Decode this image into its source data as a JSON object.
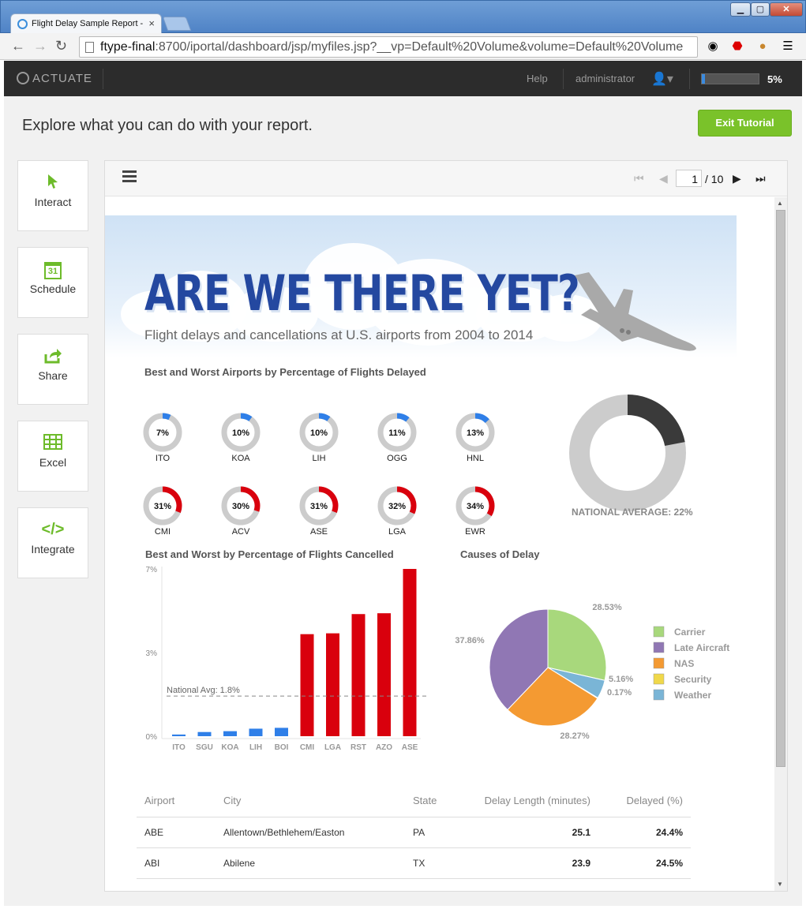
{
  "browser": {
    "tab_title": "Flight Delay Sample Report - ",
    "tab_close": "×",
    "url_host": "ftype-final",
    "url_rest": ":8700/iportal/dashboard/jsp/myfiles.jsp?__vp=Default%20Volume&volume=Default%20Volume"
  },
  "app": {
    "logo": "ACTUATE",
    "help": "Help",
    "user": "administrator",
    "progress_text": "5%",
    "progress_fraction": 0.05
  },
  "tutorial": {
    "heading": "Explore what you can do with your report.",
    "exit_label": "Exit Tutorial",
    "sidebar": [
      {
        "label": "Interact",
        "icon": "cursor-icon"
      },
      {
        "label": "Schedule",
        "icon": "calendar-icon",
        "icon_text": "31"
      },
      {
        "label": "Share",
        "icon": "share-icon"
      },
      {
        "label": "Excel",
        "icon": "grid-icon"
      },
      {
        "label": "Integrate",
        "icon": "code-icon",
        "icon_text": "</>"
      }
    ]
  },
  "viewer": {
    "page_current": "1",
    "page_total": "/ 10"
  },
  "report": {
    "title": "ARE WE THERE YET?",
    "subtitle": "Flight delays and cancellations at U.S. airports from 2004 to 2014",
    "delayed_title": "Best and Worst Airports by Percentage of Flights Delayed",
    "cancelled_title": "Best and Worst by Percentage of Flights Cancelled",
    "causes_title": "Causes of Delay",
    "national_avg_label": "NATIONAL AVERAGE: 22%",
    "table": {
      "headers": [
        "Airport",
        "City",
        "State",
        "Delay Length (minutes)",
        "Delayed (%)"
      ],
      "rows": [
        [
          "ABE",
          "Allentown/Bethlehem/Easton",
          "PA",
          "25.1",
          "24.4%"
        ],
        [
          "ABI",
          "Abilene",
          "TX",
          "23.9",
          "24.5%"
        ]
      ]
    }
  },
  "colors": {
    "best_arc": "#2f7fe8",
    "worst_arc": "#d9000d",
    "ring_bg": "#cccccc",
    "nat_dark": "#3a3a3a"
  },
  "chart_data": [
    {
      "type": "donut",
      "title": "Best and Worst Airports by Percentage of Flights Delayed",
      "best": [
        {
          "label": "ITO",
          "value": 7,
          "text": "7%"
        },
        {
          "label": "KOA",
          "value": 10,
          "text": "10%"
        },
        {
          "label": "LIH",
          "value": 10,
          "text": "10%"
        },
        {
          "label": "OGG",
          "value": 11,
          "text": "11%"
        },
        {
          "label": "HNL",
          "value": 13,
          "text": "13%"
        }
      ],
      "worst": [
        {
          "label": "CMI",
          "value": 31,
          "text": "31%"
        },
        {
          "label": "ACV",
          "value": 30,
          "text": "30%"
        },
        {
          "label": "ASE",
          "value": 31,
          "text": "31%"
        },
        {
          "label": "LGA",
          "value": 32,
          "text": "32%"
        },
        {
          "label": "EWR",
          "value": 34,
          "text": "34%"
        }
      ],
      "national_average": 22
    },
    {
      "type": "bar",
      "title": "Best and Worst by Percentage of Flights Cancelled",
      "categories": [
        "ITO",
        "SGU",
        "KOA",
        "LIH",
        "BOI",
        "CMI",
        "LGA",
        "RST",
        "AZO",
        "ASE"
      ],
      "values": [
        0.1,
        0.25,
        0.3,
        0.45,
        0.5,
        6.1,
        6.15,
        7.3,
        7.35,
        10.0
      ],
      "series_colors": [
        "#2f7fe8",
        "#2f7fe8",
        "#2f7fe8",
        "#2f7fe8",
        "#2f7fe8",
        "#d9000d",
        "#d9000d",
        "#d9000d",
        "#d9000d",
        "#d9000d"
      ],
      "yticks": [
        {
          "value": 0,
          "label": "0%"
        },
        {
          "value": 5,
          "label": "3%"
        },
        {
          "value": 10,
          "label": "7%"
        }
      ],
      "ylim": [
        0,
        10
      ],
      "reference_line": {
        "value": 2.4,
        "label": "National Avg:  1.8%"
      }
    },
    {
      "type": "pie",
      "title": "Causes of Delay",
      "slices": [
        {
          "name": "Carrier",
          "value": 28.53,
          "label": "28.53%",
          "color": "#a8d87c"
        },
        {
          "name": "Weather",
          "value": 5.16,
          "label": "5.16%",
          "color": "#7ab5d6"
        },
        {
          "name": "Security",
          "value": 0.17,
          "label": "0.17%",
          "color": "#f0d84a"
        },
        {
          "name": "NAS",
          "value": 28.27,
          "label": "28.27%",
          "color": "#f49a32"
        },
        {
          "name": "Late Aircraft",
          "value": 37.86,
          "label": "37.86%",
          "color": "#9077b4"
        }
      ],
      "legend": [
        "Carrier",
        "Late Aircraft",
        "NAS",
        "Security",
        "Weather"
      ],
      "legend_position": "right"
    }
  ]
}
